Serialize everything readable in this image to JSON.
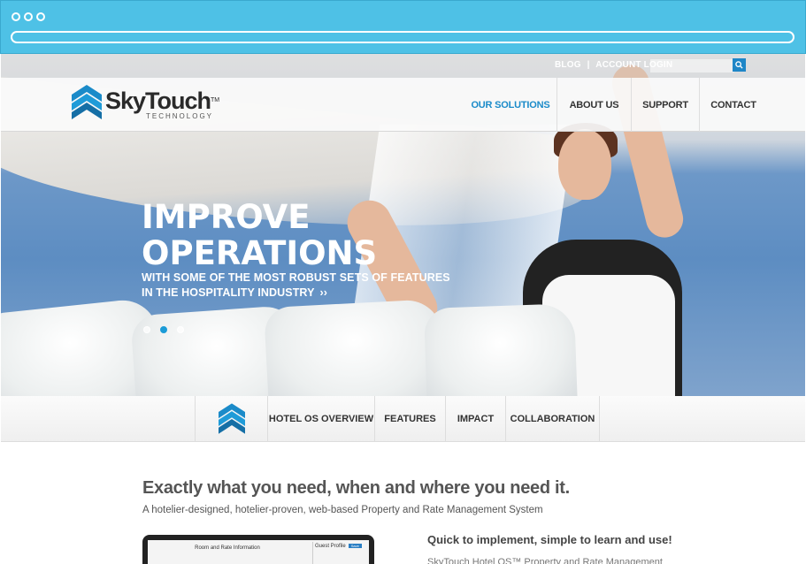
{
  "browser": {
    "dots": 3
  },
  "utility": {
    "blog": "BLOG",
    "separator": "|",
    "account_login": "ACCOUNT LOGIN",
    "search_placeholder": ""
  },
  "brand": {
    "name": "SkyTouch",
    "tm": "TM",
    "subtitle": "TECHNOLOGY",
    "primary_color": "#1b8bc9"
  },
  "main_nav": [
    {
      "label": "OUR SOLUTIONS",
      "active": true
    },
    {
      "label": "ABOUT US",
      "active": false
    },
    {
      "label": "SUPPORT",
      "active": false
    },
    {
      "label": "CONTACT",
      "active": false
    }
  ],
  "hero": {
    "title_line1": "IMPROVE",
    "title_line2": "OPERATIONS",
    "sub_line1": "WITH SOME OF THE MOST ROBUST SETS OF FEATURES",
    "sub_line2": "IN THE HOSPITALITY INDUSTRY",
    "more_glyph": "››",
    "slide_count": 3,
    "active_slide": 2
  },
  "sub_nav": [
    {
      "label": "HOTEL OS OVERVIEW"
    },
    {
      "label": "FEATURES"
    },
    {
      "label": "IMPACT"
    },
    {
      "label": "COLLABORATION"
    }
  ],
  "content": {
    "heading": "Exactly what you need, when and where you need it.",
    "subheading": "A hotelier-designed, hotelier-proven, web-based Property and Rate Management System",
    "screen_title": "Room and Rate Information",
    "screen_panel_title": "Guest Profile",
    "screen_panel_button": "Save",
    "right_heading": "Quick to implement, simple to learn and use!",
    "right_text": "SkyTouch Hotel OS™ Property and Rate Management"
  }
}
